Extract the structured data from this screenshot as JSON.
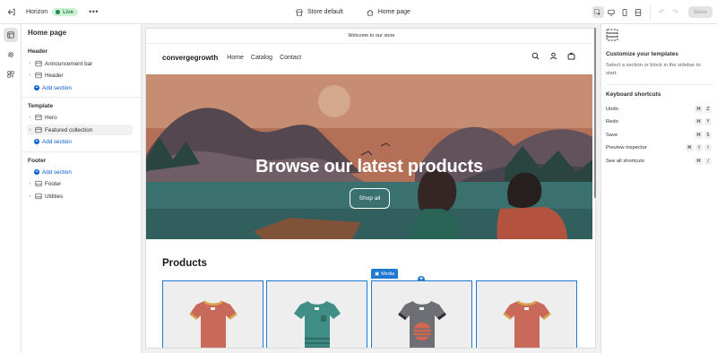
{
  "topbar": {
    "theme_name": "Horizon",
    "status_badge": "Live",
    "store_picker": "Store default",
    "page_picker": "Home page",
    "save_label": "Save"
  },
  "sidebar": {
    "title": "Home page",
    "groups": [
      {
        "title": "Header",
        "items": [
          "Announcement bar",
          "Header"
        ],
        "add_label": "Add section"
      },
      {
        "title": "Template",
        "items": [
          "Hero",
          "Featured collection"
        ],
        "add_label": "Add section"
      },
      {
        "title": "Footer",
        "items": [
          "Footer",
          "Utilities"
        ],
        "add_label": "Add section"
      }
    ],
    "selected_item": "Featured collection"
  },
  "preview": {
    "announcement": "Welcome to our store",
    "brand": "convergegrowth",
    "nav": [
      "Home",
      "Catalog",
      "Contact"
    ],
    "hero_title": "Browse our latest products",
    "hero_button": "Shop all",
    "products_title": "Products",
    "media_tag": "Media",
    "product_colors": [
      "#c9695a",
      "#3f8f86",
      "#6d6f75",
      "#c9695a"
    ]
  },
  "right_panel": {
    "heading": "Customize your templates",
    "description": "Select a section or block in the sidebar to start.",
    "shortcuts_heading": "Keyboard shortcuts",
    "shortcuts": [
      {
        "label": "Undo",
        "keys": [
          "⌘",
          "Z"
        ]
      },
      {
        "label": "Redo",
        "keys": [
          "⌘",
          "Y"
        ]
      },
      {
        "label": "Save",
        "keys": [
          "⌘",
          "S"
        ]
      },
      {
        "label": "Preview inspector",
        "keys": [
          "⌘",
          "⇧",
          "I"
        ]
      },
      {
        "label": "See all shortcuts",
        "keys": [
          "⌘",
          "/"
        ]
      }
    ]
  },
  "colors": {
    "accent": "#005bd3",
    "selection_blue": "#1f78d1",
    "live_green": "#29845a"
  }
}
